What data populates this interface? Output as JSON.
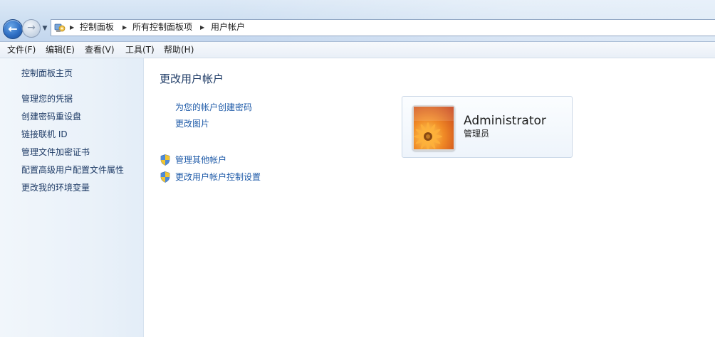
{
  "breadcrumb": {
    "items": [
      "控制面板",
      "所有控制面板项",
      "用户帐户"
    ]
  },
  "menu": {
    "items": [
      "文件(F)",
      "编辑(E)",
      "查看(V)",
      "工具(T)",
      "帮助(H)"
    ]
  },
  "sidebar": {
    "home": "控制面板主页",
    "links": [
      "管理您的凭据",
      "创建密码重设盘",
      "链接联机 ID",
      "管理文件加密证书",
      "配置高级用户配置文件属性",
      "更改我的环境变量"
    ]
  },
  "main": {
    "title": "更改用户帐户",
    "links": [
      "为您的帐户创建密码",
      "更改图片"
    ],
    "shield_links": [
      "管理其他帐户",
      "更改用户帐户控制设置"
    ]
  },
  "account": {
    "name": "Administrator",
    "role": "管理员"
  },
  "icons": {
    "back": "back-arrow-icon",
    "forward": "forward-arrow-icon",
    "control_panel": "control-panel-icon",
    "shield": "uac-shield-icon",
    "account_picture": "flower-picture-icon"
  },
  "colors": {
    "link": "#1e5aa8",
    "nav_bg": "#cfe0f2",
    "sidebar_bg": "#e9f1f9"
  }
}
